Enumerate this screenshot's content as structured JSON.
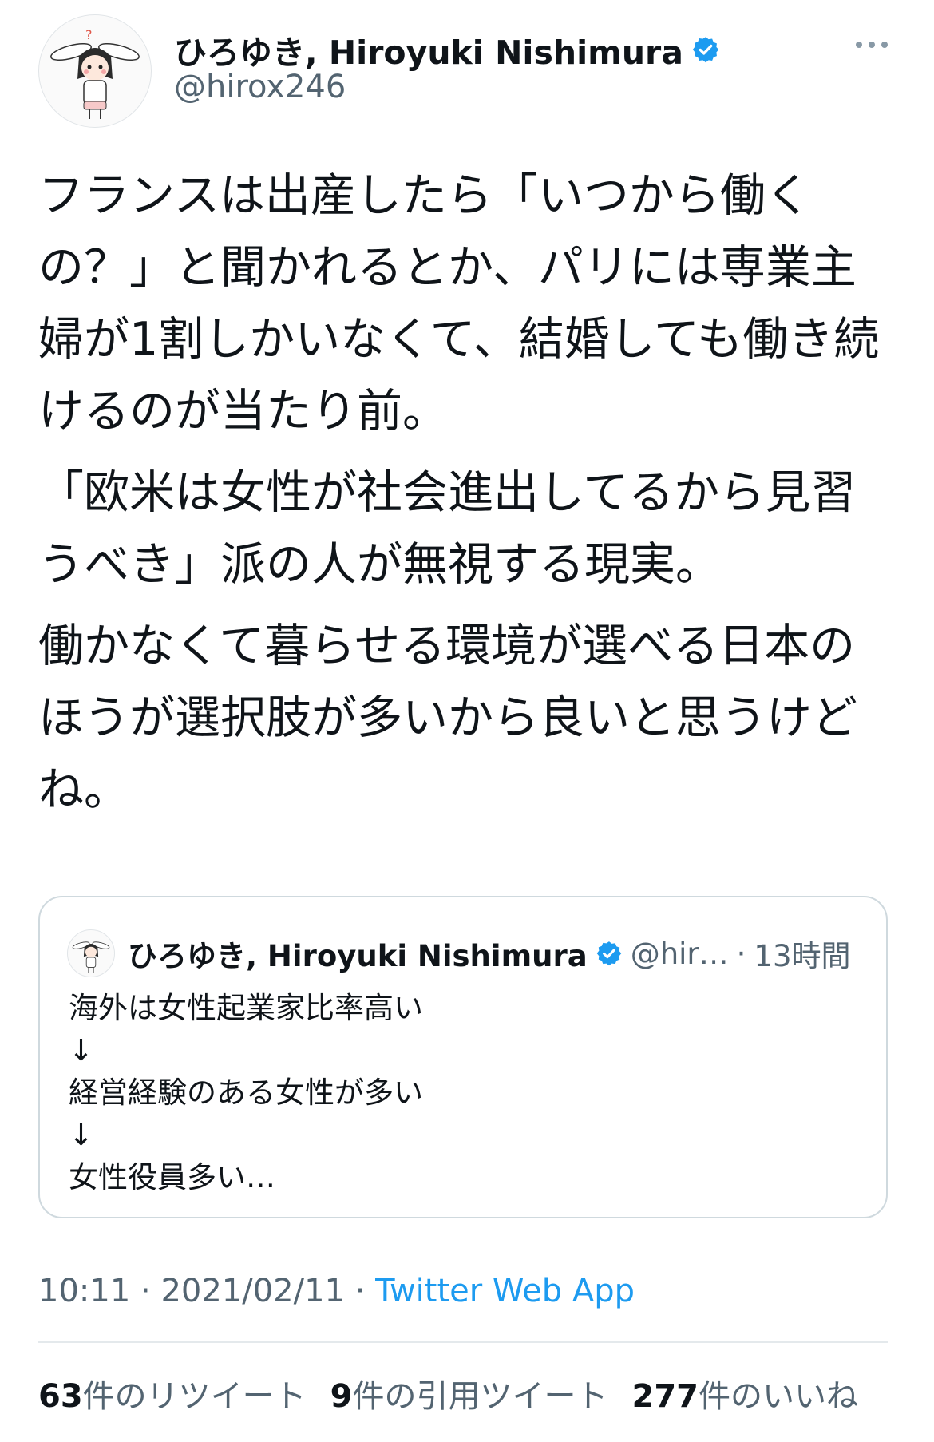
{
  "author": {
    "display_name": "ひろゆき, Hiroyuki Nishimura",
    "handle": "@hirox246",
    "verified_icon": "verified-badge-icon",
    "avatar_icon": "bunny-ears-character-avatar"
  },
  "tweet": {
    "paragraphs": [
      "フランスは出産したら「いつから働くの？」と聞かれるとか、パリには専業主婦が1割しかいなくて、結婚しても働き続けるのが当たり前。",
      "「欧米は女性が社会進出してるから見習うべき」派の人が無視する現実。",
      "働かなくて暮らせる環境が選べる日本のほうが選択肢が多いから良いと思うけどね。"
    ]
  },
  "quote": {
    "display_name": "ひろゆき, Hiroyuki Nishimura",
    "handle": "@hir…",
    "separator": "·",
    "time": "13時間",
    "body": "海外は女性起業家比率高い\n↓\n経営経験のある女性が多い\n↓\n女性役員多い…"
  },
  "meta": {
    "time": "10:11",
    "sep1": "·",
    "date": "2021/02/11",
    "sep2": "·",
    "source": "Twitter Web App"
  },
  "stats": {
    "retweets_count": "63",
    "retweets_label": "件のリツイート",
    "quotes_count": "9",
    "quotes_label": "件の引用ツイート",
    "likes_count": "277",
    "likes_label": "件のいいね"
  },
  "colors": {
    "link": "#1d9bf0",
    "verified": "#1d9bf0",
    "secondary_text": "#536471",
    "border": "#cfd9de"
  }
}
